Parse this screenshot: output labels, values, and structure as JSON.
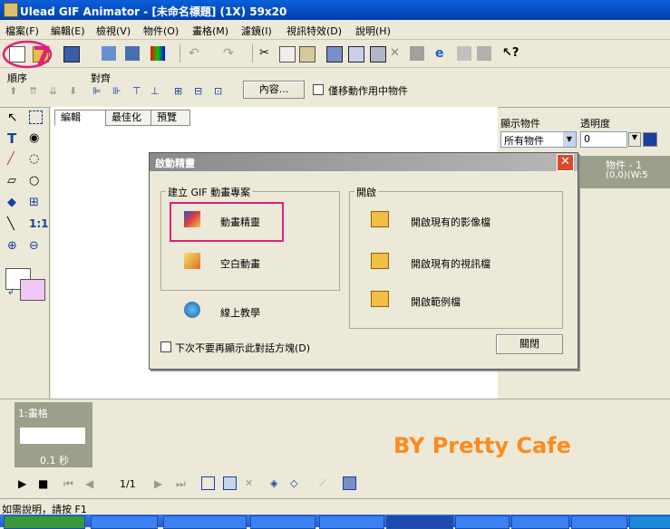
{
  "window": {
    "title": "Ulead GIF Animator - [未命名標題] (1X) 59x20"
  },
  "menu": [
    "檔案(F)",
    "編輯(E)",
    "檢視(V)",
    "物件(O)",
    "畫格(M)",
    "濾鏡(I)",
    "視訊特效(D)",
    "說明(H)"
  ],
  "toolbar2": {
    "order_label": "順序",
    "align_label": "對齊",
    "content_button": "內容...",
    "move_only_label": "僅移動作用中物件"
  },
  "tabs": [
    "編輯",
    "最佳化",
    "預覽"
  ],
  "right_panel": {
    "display_label": "顯示物件",
    "display_value": "所有物件",
    "opacity_label": "透明度",
    "opacity_value": "0",
    "object_name": "物件 - 1",
    "object_info": "(0,0)(W:5"
  },
  "dialog": {
    "title": "啟動精靈",
    "left_group": "建立 GIF 動畫專案",
    "wizard": "動畫精靈",
    "blank": "空白動畫",
    "tutorial": "線上教學",
    "right_group": "開啟",
    "open_image": "開啟現有的影像檔",
    "open_video": "開啟現有的視訊檔",
    "open_sample": "開啟範例檔",
    "dont_show": "下次不要再顯示此對話方塊(D)",
    "close": "關閉"
  },
  "frame_panel": {
    "frame_label": "1:畫格",
    "frame_time": "0.1 秒",
    "watermark": "BY   Pretty Cafe"
  },
  "playback": {
    "counter": "1/1"
  },
  "status": "如需說明，請按 F1",
  "annotation": "7",
  "colors": {
    "highlight": "#e0207a",
    "title_blue": "#0a5fd8",
    "watermark": "#ff8a1c",
    "secondary_color": "#f0c8f6"
  }
}
